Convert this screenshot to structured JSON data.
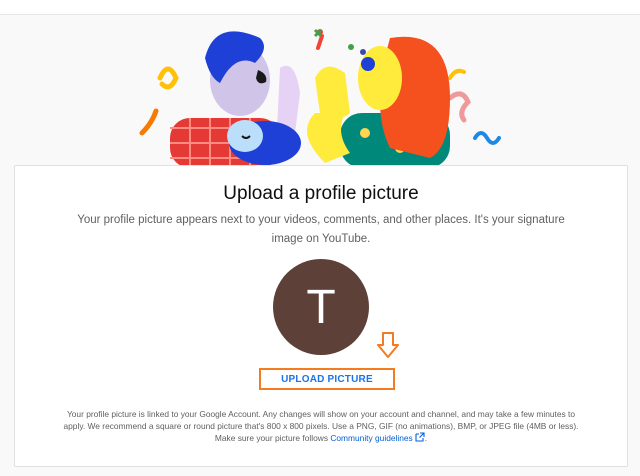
{
  "header": {},
  "dialog": {
    "title": "Upload a profile picture",
    "subtitle": "Your profile picture appears next to your videos, comments, and other places. It's your signature image on YouTube.",
    "avatar_letter": "T",
    "avatar_color": "#5d4037",
    "highlight_color": "#f47b20",
    "upload_button_label": "UPLOAD PICTURE",
    "footnote_lines": [
      "Your profile picture is linked to your Google Account. Any changes will show on your account and channel, and may take a few minutes to",
      "apply. We recommend a square or round picture that's 800 x 800 pixels. Use a PNG, GIF (no animations), BMP, or JPEG file (4MB or less)."
    ],
    "footnote_prefix": "Make sure your picture follows",
    "guidelines_link": "Community guidelines",
    "footnote_suffix": ".",
    "icons": {
      "arrow": "arrow-down-icon",
      "external": "external-link-icon"
    }
  }
}
